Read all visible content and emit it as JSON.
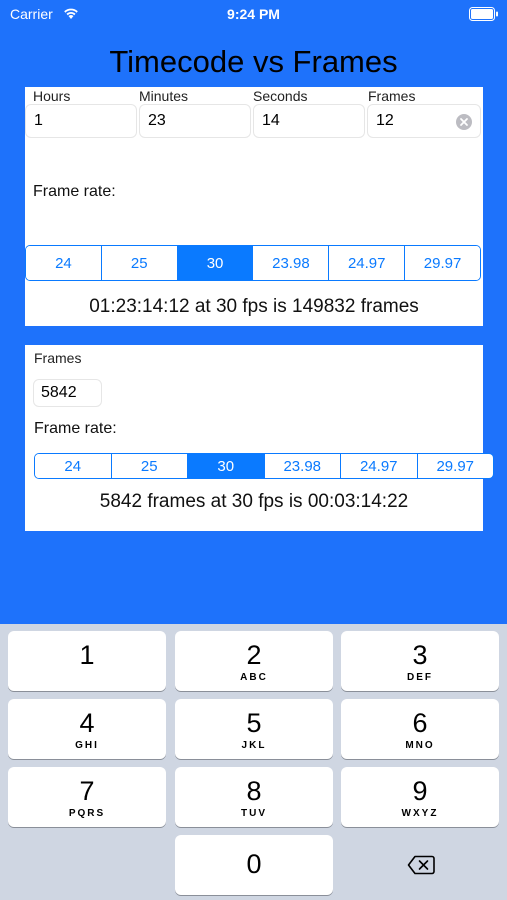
{
  "status_bar": {
    "carrier": "Carrier",
    "time": "9:24 PM"
  },
  "title": "Timecode vs Frames",
  "timecode": {
    "labels": [
      "Hours",
      "Minutes",
      "Seconds",
      "Frames"
    ],
    "values": [
      "1",
      "23",
      "14",
      "12"
    ],
    "frame_rate_label": "Frame rate:",
    "frame_rates": [
      "24",
      "25",
      "30",
      "23.98",
      "24.97",
      "29.97"
    ],
    "selected_rate": "30",
    "result": "01:23:14:12 at 30 fps is 149832 frames"
  },
  "frames": {
    "label": "Frames",
    "value": "5842",
    "frame_rate_label": "Frame rate:",
    "frame_rates": [
      "24",
      "25",
      "30",
      "23.98",
      "24.97",
      "29.97"
    ],
    "selected_rate": "30",
    "result": "5842 frames at 30 fps is 00:03:14:22"
  },
  "keyboard": {
    "keys": [
      {
        "digit": "1",
        "letters": ""
      },
      {
        "digit": "2",
        "letters": "ABC"
      },
      {
        "digit": "3",
        "letters": "DEF"
      },
      {
        "digit": "4",
        "letters": "GHI"
      },
      {
        "digit": "5",
        "letters": "JKL"
      },
      {
        "digit": "6",
        "letters": "MNO"
      },
      {
        "digit": "7",
        "letters": "PQRS"
      },
      {
        "digit": "8",
        "letters": "TUV"
      },
      {
        "digit": "9",
        "letters": "WXYZ"
      },
      {
        "digit": "0",
        "letters": ""
      }
    ],
    "delete_icon": "backspace-icon"
  },
  "colors": {
    "background": "#1E72FB",
    "accent": "#0A7AFF",
    "keyboard": "#CFD6E2"
  }
}
